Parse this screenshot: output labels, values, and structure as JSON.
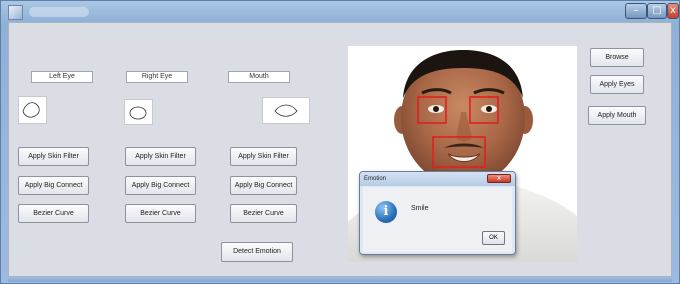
{
  "window": {
    "title": "",
    "controls": {
      "minimize_icon": "minimize-icon",
      "maximize_icon": "maximize-icon",
      "close_icon": "close-icon",
      "close_glyph": "x"
    }
  },
  "labels": {
    "left_eye": "Left Eye",
    "right_eye": "Right Eye",
    "mouth": "Mouth"
  },
  "columns": {
    "left_eye": {
      "skin_filter": "Apply Skin Filter",
      "big_connect": "Apply Big Connect",
      "bezier": "Bezier Curve"
    },
    "right_eye": {
      "skin_filter": "Apply Skin Filter",
      "big_connect": "Apply Big Connect",
      "bezier": "Bezier Curve"
    },
    "mouth": {
      "skin_filter": "Apply Skin Filter",
      "big_connect": "Apply Big Connect",
      "bezier": "Bezier Curve"
    }
  },
  "detect_button": "Detect Emotion",
  "right_panel": {
    "browse": "Browse",
    "apply_eyes": "Apply Eyes",
    "apply_mouth": "Apply Mouth"
  },
  "dialog": {
    "title": "Emotion",
    "icon": "info-icon",
    "icon_glyph": "i",
    "message": "Smile",
    "ok": "OK",
    "close_glyph": "x"
  },
  "colors": {
    "detection_box": "#e02020",
    "window_frame": "#9dbbe0",
    "client_bg": "#dadde4"
  }
}
